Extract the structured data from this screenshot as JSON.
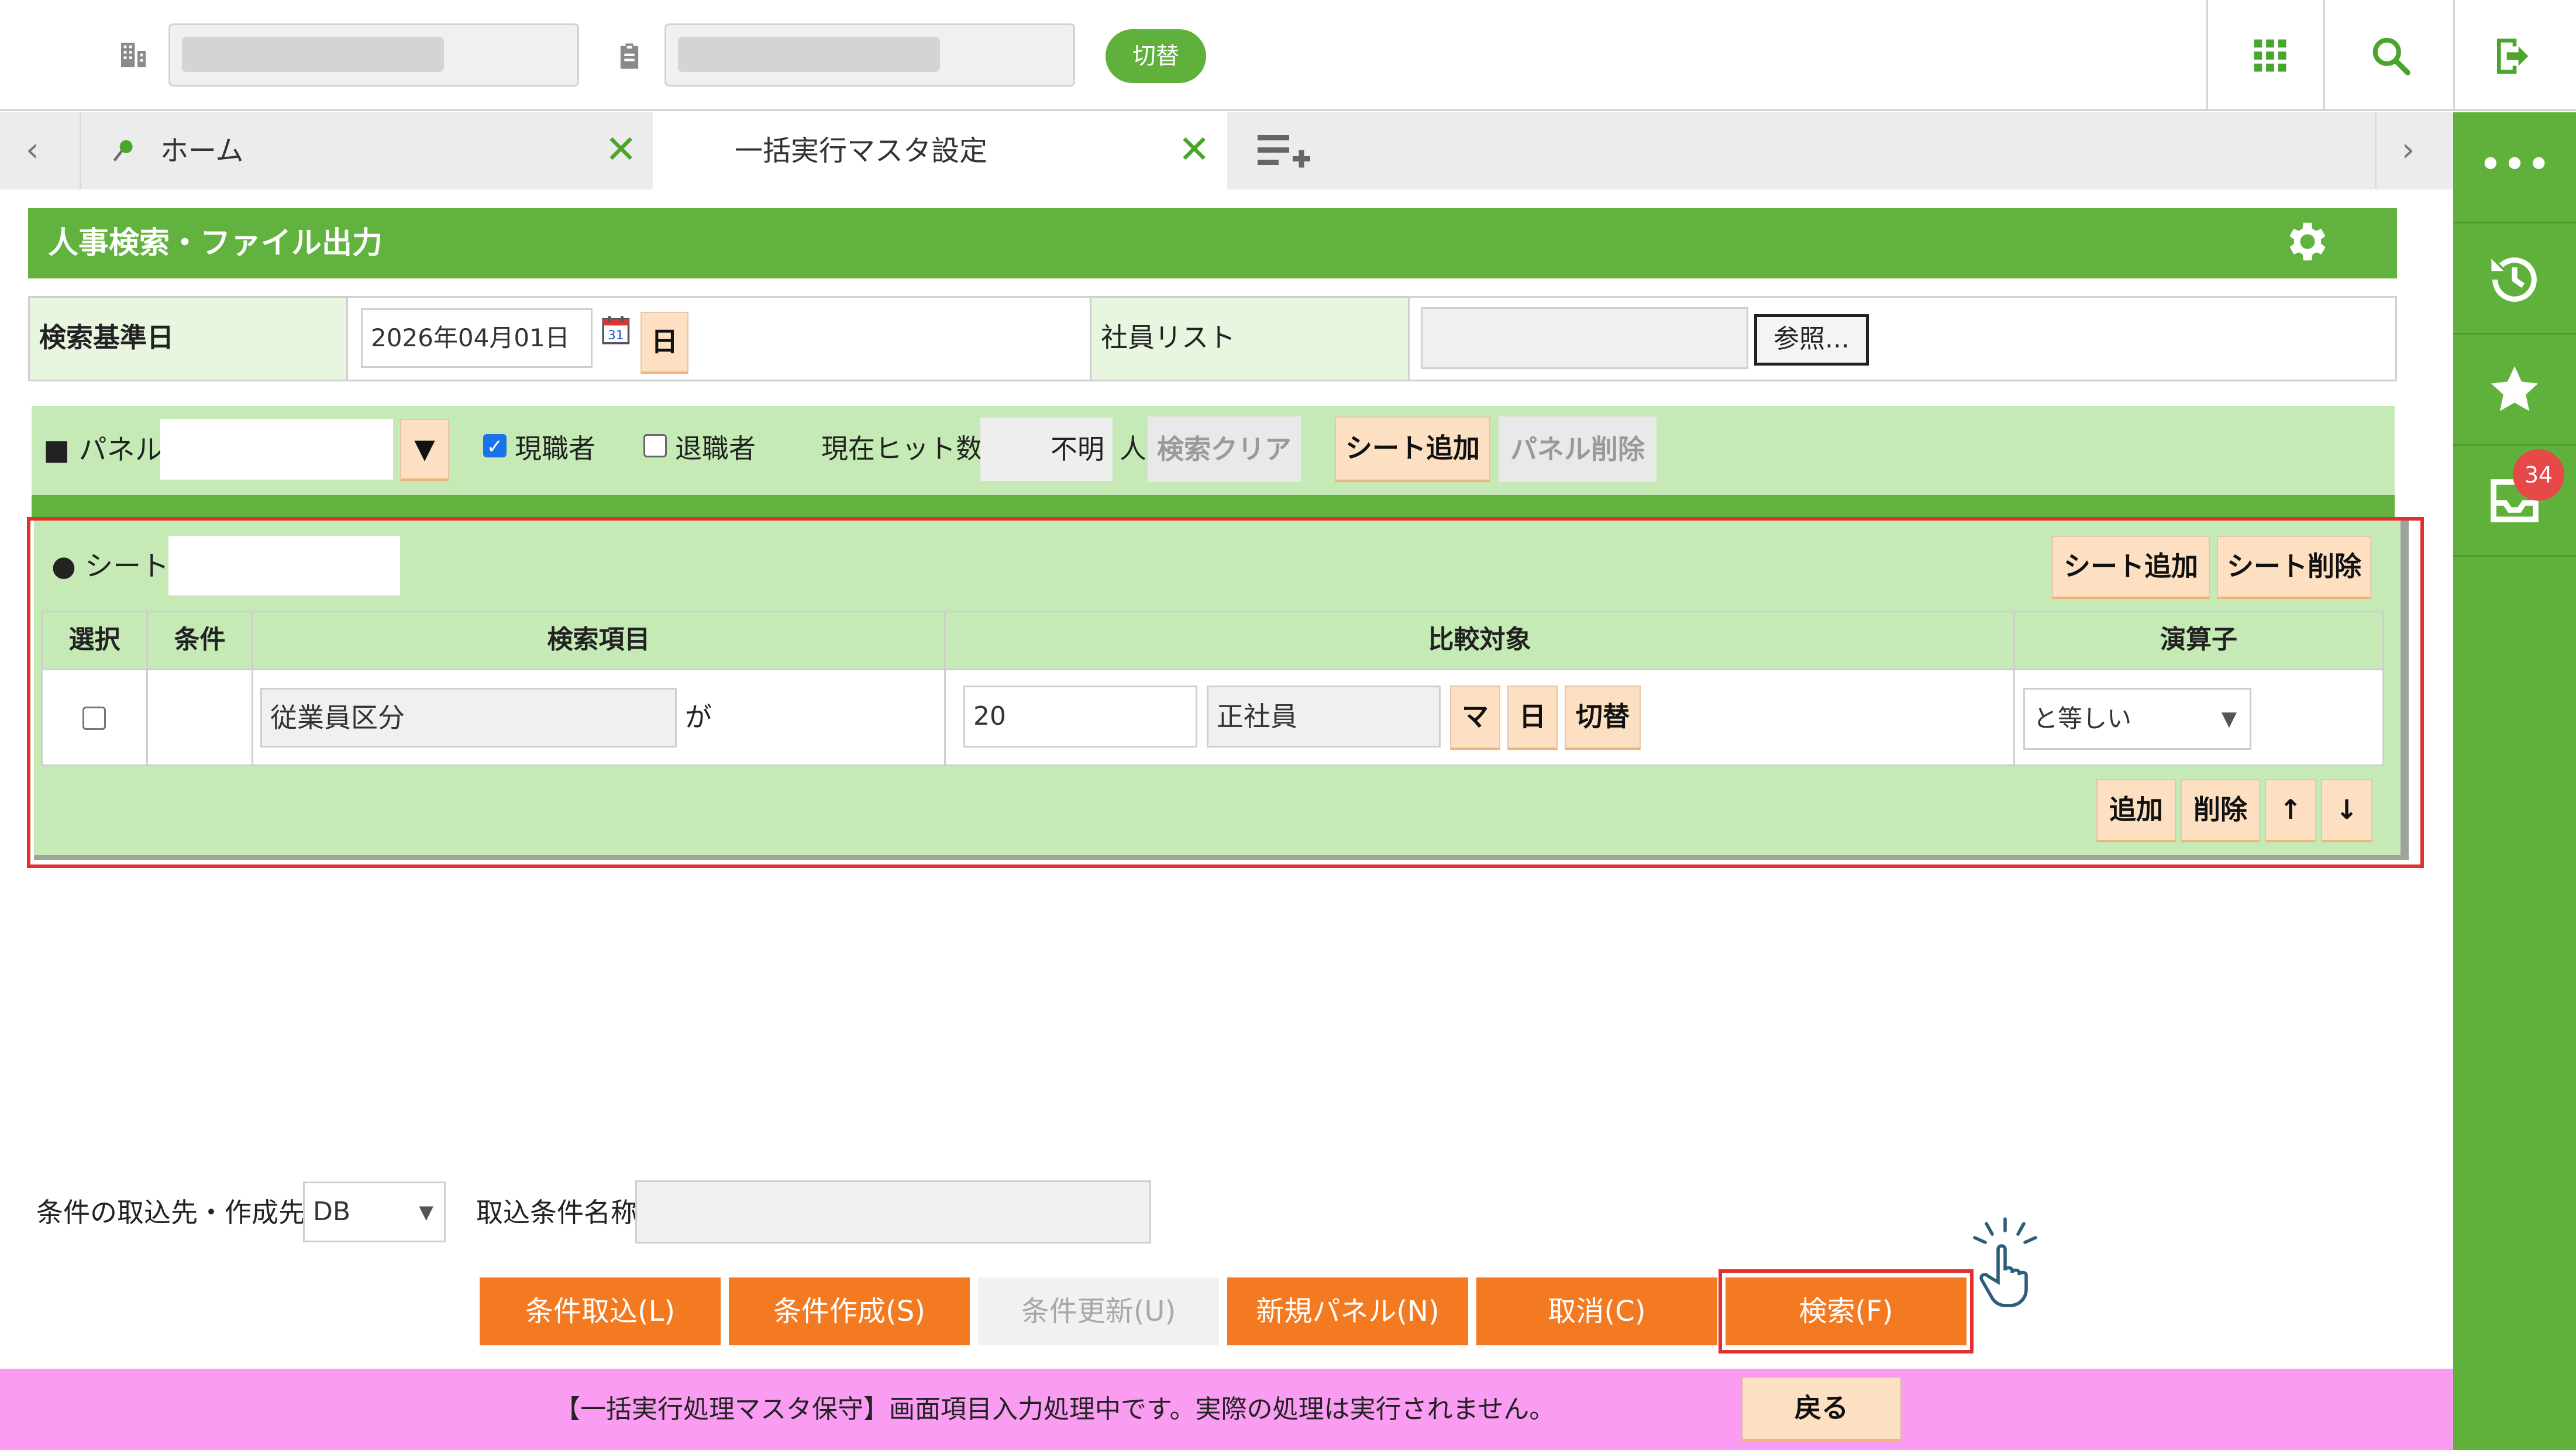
{
  "header": {
    "switch_label": "切替",
    "icons": {
      "company": "building-icon",
      "clipboard": "clipboard-icon",
      "apps": "grid-icon",
      "search": "search-icon",
      "logout": "logout-icon"
    }
  },
  "tabs": {
    "items": [
      {
        "label": "ホーム",
        "icon": "pin-icon"
      },
      {
        "label": "一括実行マスタ設定"
      }
    ]
  },
  "sidebar": {
    "badge_count": "34",
    "items": [
      "more-icon",
      "history-icon",
      "star-icon",
      "inbox-icon"
    ]
  },
  "page": {
    "title": "人事検索・ファイル出力"
  },
  "criteria": {
    "date_label": "検索基準日",
    "date_value": "2026年04月01日",
    "day_button": "日",
    "employee_list_label": "社員リスト",
    "browse_button": "参照..."
  },
  "panel": {
    "label": "■ パネル",
    "dropdown_button": "▼",
    "current_employee_label": "現職者",
    "current_employee_checked": true,
    "retired_label": "退職者",
    "retired_checked": false,
    "hit_label": "現在ヒット数",
    "hit_value": "不明",
    "hit_unit": "人",
    "clear_button": "検索クリア",
    "add_sheet_button": "シート追加",
    "delete_panel_button": "パネル削除"
  },
  "sheet": {
    "label": "● シート",
    "add_sheet_button": "シート追加",
    "delete_sheet_button": "シート削除",
    "columns": [
      "選択",
      "条件",
      "検索項目",
      "比較対象",
      "演算子"
    ],
    "row": {
      "search_item": "従業員区分",
      "particle": "が",
      "code_value": "20",
      "name_value": "正社員",
      "btn_master": "マ",
      "btn_day": "日",
      "btn_switch": "切替",
      "operator": "と等しい"
    },
    "add_button": "追加",
    "delete_button": "削除",
    "up_button": "↑",
    "down_button": "↓"
  },
  "footer": {
    "source_label": "条件の取込先・作成先",
    "source_value": "DB",
    "condition_name_label": "取込条件名称",
    "buttons": {
      "import": "条件取込(L)",
      "create": "条件作成(S)",
      "update": "条件更新(U)",
      "new_panel": "新規パネル(N)",
      "cancel": "取消(C)",
      "search": "検索(F)"
    }
  },
  "status": {
    "message": "【一括実行処理マスタ保守】画面項目入力処理中です。実際の処理は実行されません。",
    "back_button": "戻る"
  }
}
